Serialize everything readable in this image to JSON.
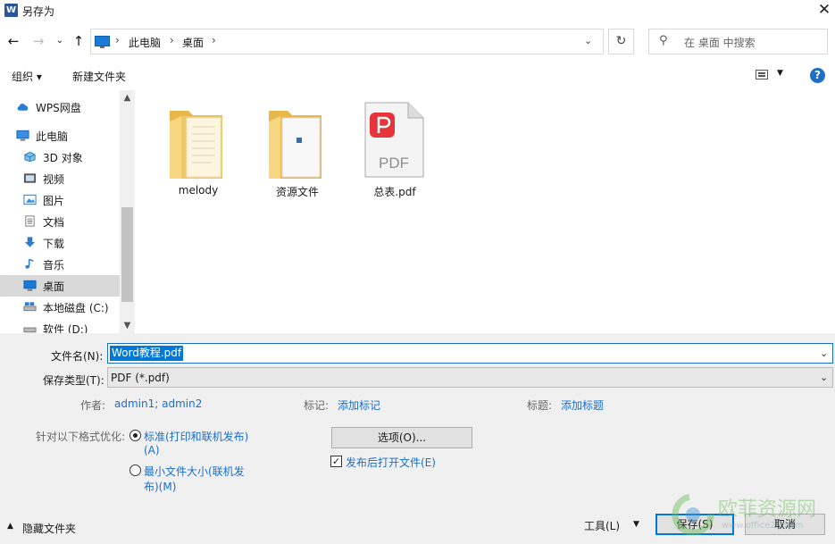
{
  "window": {
    "title": "另存为",
    "app_icon_letter": "W",
    "close_glyph": "✕"
  },
  "nav": {
    "back": "←",
    "forward": "→",
    "recent": "⌄",
    "up": "↑",
    "breadcrumb": [
      "此电脑",
      "桌面"
    ],
    "sep": "›",
    "dropdown": "⌄",
    "refresh": "↻",
    "search_placeholder": "在 桌面 中搜索",
    "search_icon": "⚲"
  },
  "commands": {
    "organize": "组织 ▾",
    "new_folder": "新建文件夹",
    "view_dd": "▼",
    "help": "?"
  },
  "sidebar": {
    "items": [
      {
        "label": "WPS网盘",
        "icon": "cloud-icon"
      },
      {
        "label": "此电脑",
        "icon": "computer-icon"
      },
      {
        "label": "3D 对象",
        "icon": "3d-objects-icon"
      },
      {
        "label": "视频",
        "icon": "video-icon"
      },
      {
        "label": "图片",
        "icon": "pictures-icon"
      },
      {
        "label": "文档",
        "icon": "documents-icon"
      },
      {
        "label": "下载",
        "icon": "download-icon"
      },
      {
        "label": "音乐",
        "icon": "music-icon"
      },
      {
        "label": "桌面",
        "icon": "desktop-icon"
      },
      {
        "label": "本地磁盘 (C:)",
        "icon": "drive-c-icon"
      },
      {
        "label": "软件 (D:)",
        "icon": "drive-d-icon"
      }
    ],
    "scroll_up": "▲",
    "scroll_down": "▼"
  },
  "files": [
    {
      "name": "melody",
      "icon": "folder-icon"
    },
    {
      "name": "资源文件",
      "icon": "folder-icon"
    },
    {
      "name": "总表.pdf",
      "icon": "pdf-file-icon",
      "badge": "PDF"
    }
  ],
  "form": {
    "filename_label": "文件名(N):",
    "filename_value": "Word教程.pdf",
    "filetype_label": "保存类型(T):",
    "filetype_value": "PDF (*.pdf)",
    "author_label": "作者:",
    "author_value": "admin1; admin2",
    "tags_label": "标记:",
    "tags_value": "添加标记",
    "title_label": "标题:",
    "title_value": "添加标题",
    "optimize_label": "针对以下格式优化:",
    "opt_standard_line1": "标准(打印和联机发布)",
    "opt_standard_line2": "(A)",
    "opt_min_line1": "最小文件大小(联机发",
    "opt_min_line2": "布)(M)",
    "options_button": "选项(O)...",
    "open_after_label": "发布后打开文件(E)",
    "check_glyph": "✓",
    "dropdown": "⌄"
  },
  "footer": {
    "hide_folders_arrow": "▲",
    "hide_folders": "隐藏文件夹",
    "tools": "工具(L)",
    "tools_dd": "▼",
    "save": "保存(S)",
    "cancel": "取消"
  },
  "watermark": {
    "text": "欧菲资源网",
    "sub": "www.office26.com"
  }
}
